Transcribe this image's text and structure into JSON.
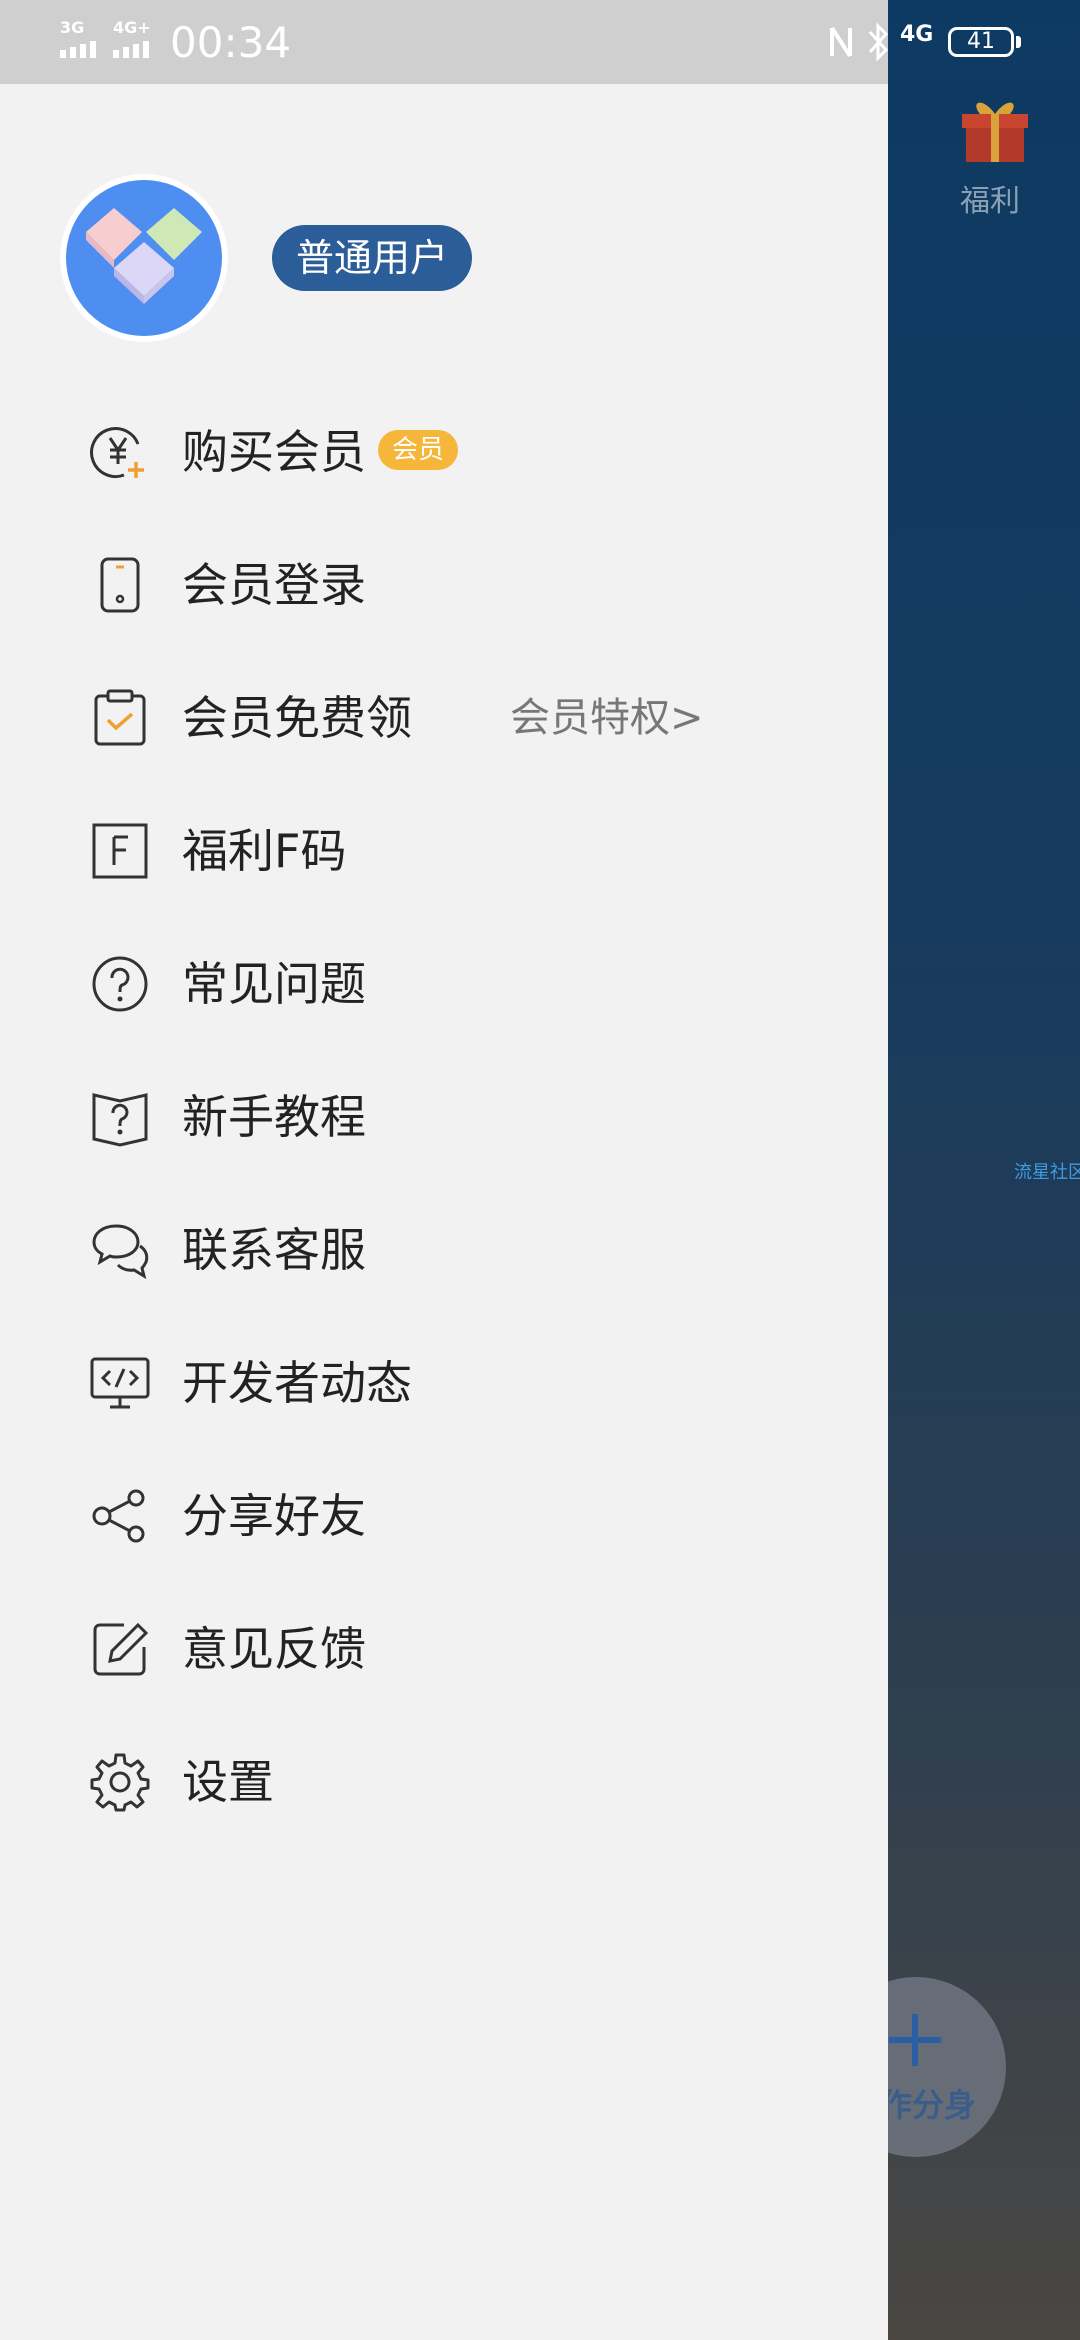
{
  "status_bar": {
    "time": "00:34",
    "signal1_label": "3G",
    "signal2_label": "4G+",
    "net_right": "4G",
    "battery": "41"
  },
  "background": {
    "gift_label": "福利",
    "community_label": "流星社区",
    "fab_label": "作分身"
  },
  "drawer": {
    "user_badge": "普通用户",
    "menu": [
      {
        "label": "购买会员",
        "icon": "yuan-plus-icon",
        "tag": "会员"
      },
      {
        "label": "会员登录",
        "icon": "phone-icon"
      },
      {
        "label": "会员免费领",
        "icon": "clipboard-check-icon",
        "link": "会员特权>"
      },
      {
        "label": "福利F码",
        "icon": "f-code-icon"
      },
      {
        "label": "常见问题",
        "icon": "question-circle-icon"
      },
      {
        "label": "新手教程",
        "icon": "book-question-icon"
      },
      {
        "label": "联系客服",
        "icon": "chat-bubbles-icon"
      },
      {
        "label": "开发者动态",
        "icon": "code-monitor-icon"
      },
      {
        "label": "分享好友",
        "icon": "share-icon"
      },
      {
        "label": "意见反馈",
        "icon": "edit-feedback-icon"
      },
      {
        "label": "设置",
        "icon": "gear-icon"
      }
    ]
  },
  "colors": {
    "accent_badge": "#2b5d98",
    "vip_tag": "#f6b63a",
    "avatar_bg": "#4e8ef0"
  }
}
